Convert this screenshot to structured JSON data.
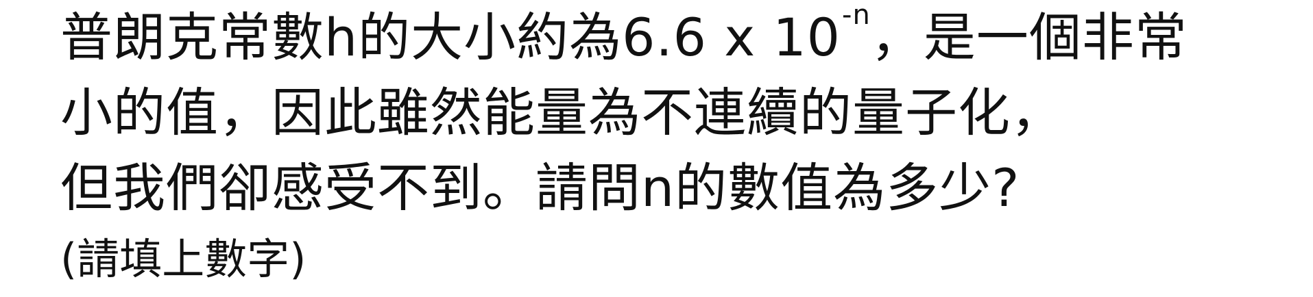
{
  "question": {
    "line1_before": "普朗克常數h的大小約為6.6 x 10",
    "line1_exponent": "-n",
    "line1_after": "，是一個非常",
    "line2": "小的值，因此雖然能量為不連續的量子化，",
    "line3": "但我們卻感受不到。請問n的數值為多少?",
    "hint": "(請填上數字)"
  }
}
